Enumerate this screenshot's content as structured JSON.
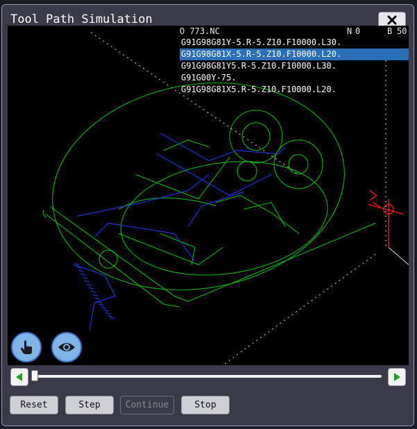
{
  "window": {
    "title": "Tool Path Simulation"
  },
  "nc": {
    "program": "O 773.NC",
    "n_label": "N",
    "n_value": "0",
    "b_label": "B",
    "b_value": "50",
    "lines": [
      "G91G98G81Y-5.R-5.Z10.F10000.L30.",
      "G91G98G81X-5.R-5.Z10.F10000.L20.",
      "G91G98G81Y5.R-5.Z10.F10000.L30.",
      "G91G00Y-75.",
      "G91G98G81X5.R-5.Z10.F10000.L20."
    ],
    "selected_index": 1
  },
  "icons": {
    "close": "close-icon",
    "hand": "hand-pointer-icon",
    "eye": "eye-icon",
    "prev": "arrow-left-icon",
    "next": "arrow-right-icon"
  },
  "progress": {
    "position_fraction": 0.0
  },
  "colors": {
    "path_green": "#00c800",
    "rapid_blue": "#1a3cff",
    "axis_red": "#ff2020",
    "selection": "#2a6fb8",
    "round_button": "#7fb4e8"
  },
  "buttons": {
    "reset": "Reset",
    "step": "Step",
    "continue": "Continue",
    "stop": "Stop"
  }
}
